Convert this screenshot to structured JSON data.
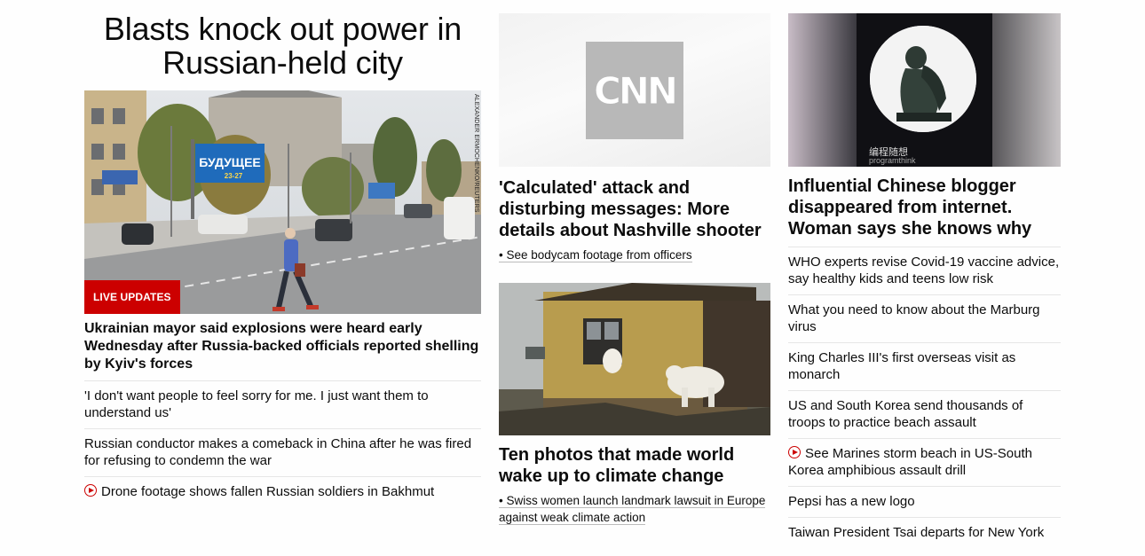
{
  "left": {
    "headline": "Blasts knock out power in Russian-held city",
    "badge": "LIVE UPDATES",
    "photo_credit": "ALEXANDER ERMOCHENKO/REUTERS",
    "billboard_text": "БУДУЩЕЕ",
    "billboard_dates": "23-27",
    "lead": "Ukrainian mayor said explosions were heard early Wednesday after Russia-backed officials reported shelling by Kyiv's forces",
    "related": [
      {
        "text": "'I don't want people to feel sorry for me. I just want them to understand us'",
        "video": false
      },
      {
        "text": "Russian conductor makes a comeback in China after he was fired for refusing to condemn the war",
        "video": false
      },
      {
        "text": "Drone footage shows fallen Russian soldiers in Bakhmut",
        "video": true
      }
    ]
  },
  "middle": {
    "card1": {
      "logo_text": "CNN",
      "headline": "'Calculated' attack and disturbing messages: More details about Nashville shooter",
      "sub": "• See bodycam footage from officers"
    },
    "card2": {
      "headline": "Ten photos that made world wake up to climate change",
      "sub": "• Swiss women launch landmark lawsuit in Europe against weak climate action"
    }
  },
  "right": {
    "image_caption_zh": "编程随想",
    "image_caption_en": "programthink",
    "headline": "Influential Chinese blogger disappeared from internet. Woman says she knows why",
    "related": [
      {
        "text": "WHO experts revise Covid-19 vaccine advice, say healthy kids and teens low risk",
        "video": false
      },
      {
        "text": "What you need to know about the Marburg virus",
        "video": false
      },
      {
        "text": "King Charles III's first overseas visit as monarch",
        "video": false
      },
      {
        "text": "US and South Korea send thousands of troops to practice beach assault",
        "video": false
      },
      {
        "text": "See Marines storm beach in US-South Korea amphibious assault drill",
        "video": true
      },
      {
        "text": "Pepsi has a new logo",
        "video": false
      },
      {
        "text": "Taiwan President Tsai departs for New York",
        "video": false
      }
    ]
  },
  "colors": {
    "accent": "#cc0000",
    "divider": "#e6e6e6"
  }
}
